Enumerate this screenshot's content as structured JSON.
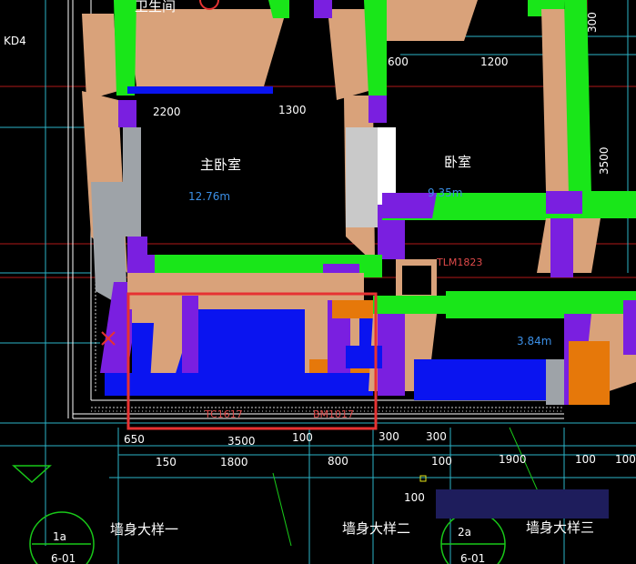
{
  "canvas": {
    "background": "#000000",
    "colors": {
      "wall_top": "#d9a27a",
      "wall_green": "#19e619",
      "column_purple": "#7a1fe0",
      "floor_blue": "#0a14f0",
      "orange": "#e6780a",
      "grey": "#9ea3a8",
      "selection": "#e63232",
      "overlay": "#1e1d5c"
    }
  },
  "labels": {
    "top_room": "卫生间",
    "axis_kd": "KD4",
    "room_master": "主卧室",
    "room_master_area": "12.76m",
    "room_bed": "卧室",
    "room_bed_area": "9.35m",
    "door_tlm": "TLM1823",
    "area_right": "3.84m",
    "door_tc": "TC1617",
    "door_bm": "BM1017",
    "dim_600": "600",
    "dim_1200": "1200",
    "dim_2200": "2200",
    "dim_1300": "1300",
    "dim_3500_v": "3500",
    "dim_300_top": "300",
    "dim_650": "650",
    "dim_3500": "3500",
    "dim_100_a": "100",
    "dim_300_a": "300",
    "dim_300_b": "300",
    "dim_150": "150",
    "dim_1800": "1800",
    "dim_800": "800",
    "dim_100_b": "100",
    "dim_1900": "1900",
    "dim_100_c": "100",
    "dim_100_d": "100",
    "dim_100_e": "100",
    "axis_1a": "1a",
    "axis_2a": "2a",
    "axis_601_left": "6-01",
    "axis_601_right": "6-01",
    "detail_1": "墙身大样一",
    "detail_2": "墙身大样二",
    "detail_3": "墙身大样三"
  }
}
